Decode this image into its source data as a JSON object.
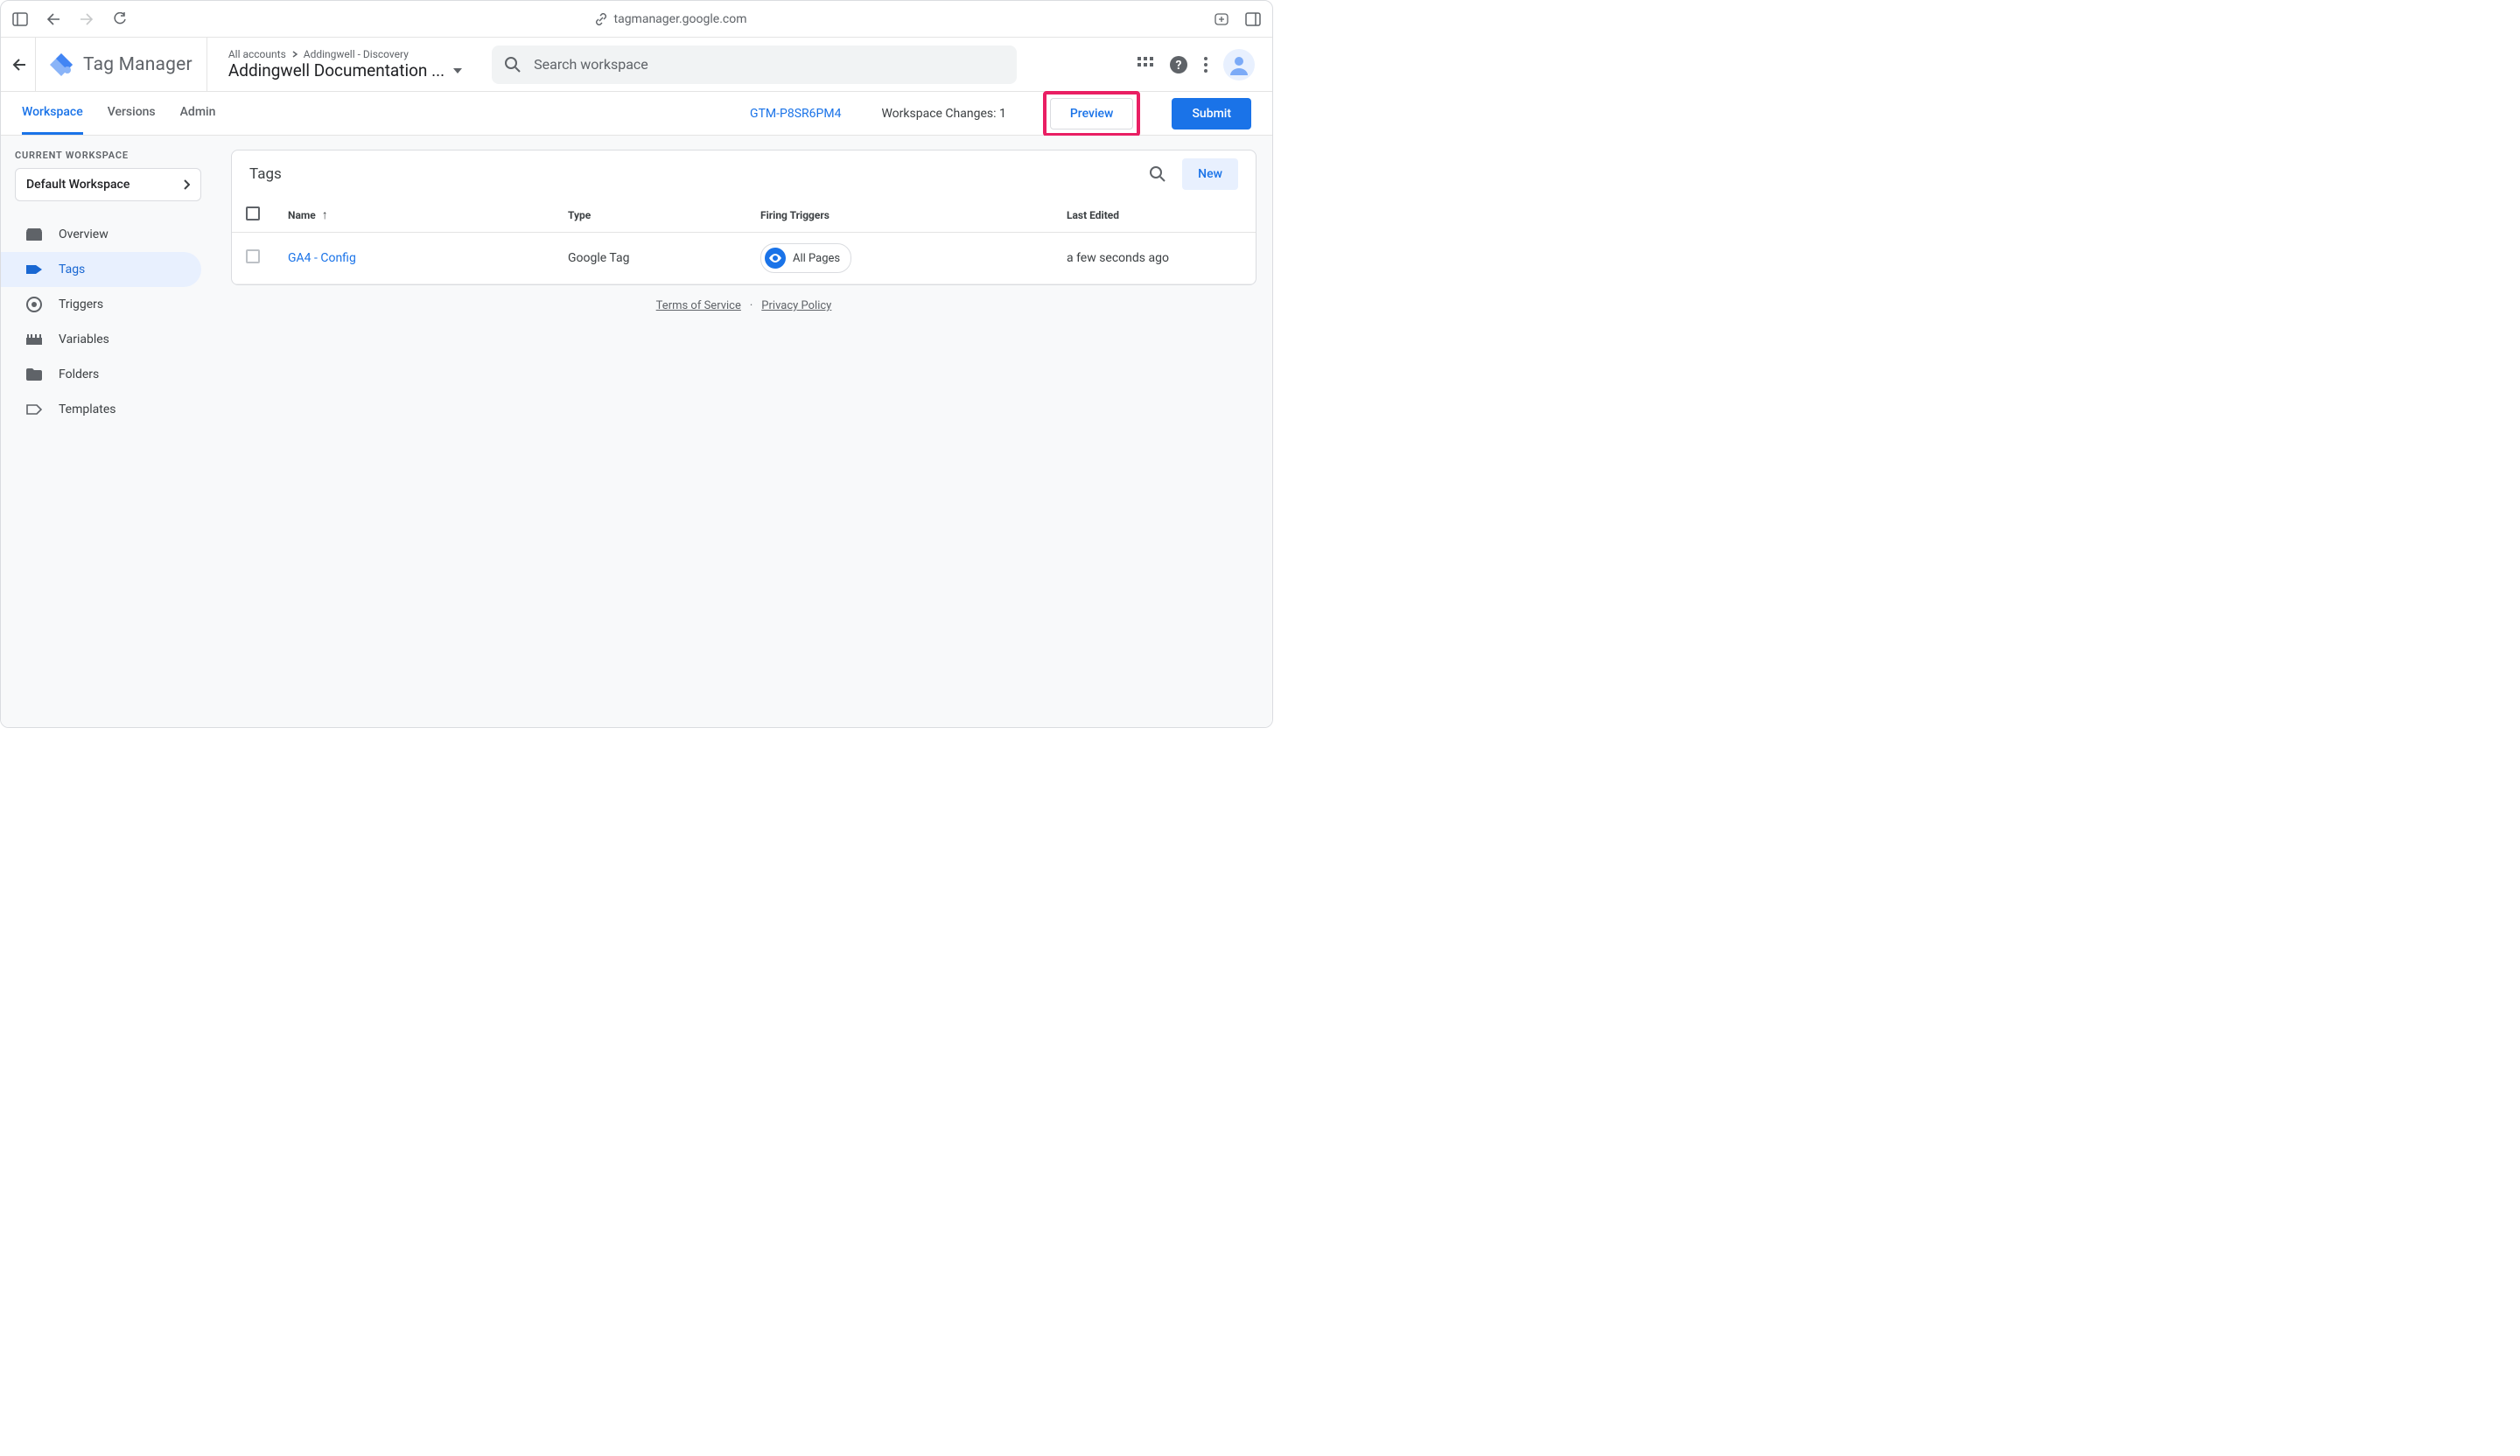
{
  "browser": {
    "url": "tagmanager.google.com"
  },
  "header": {
    "product": "Tag Manager",
    "breadcrumb_root": "All accounts",
    "breadcrumb_account": "Addingwell - Discovery",
    "container_title": "Addingwell Documentation ...",
    "search_placeholder": "Search workspace"
  },
  "tabs": {
    "workspace": "Workspace",
    "versions": "Versions",
    "admin": "Admin"
  },
  "status": {
    "container_id": "GTM-P8SR6PM4",
    "changes_label": "Workspace Changes:",
    "changes_count": "1",
    "preview": "Preview",
    "submit": "Submit"
  },
  "sidebar": {
    "section_label": "CURRENT WORKSPACE",
    "workspace_name": "Default Workspace",
    "items": {
      "overview": "Overview",
      "tags": "Tags",
      "triggers": "Triggers",
      "variables": "Variables",
      "folders": "Folders",
      "templates": "Templates"
    }
  },
  "panel": {
    "title": "Tags",
    "new_label": "New",
    "columns": {
      "name": "Name",
      "type": "Type",
      "triggers": "Firing Triggers",
      "edited": "Last Edited"
    }
  },
  "rows": [
    {
      "name": "GA4 - Config",
      "type": "Google Tag",
      "trigger": "All Pages",
      "edited": "a few seconds ago"
    }
  ],
  "footer": {
    "tos": "Terms of Service",
    "privacy": "Privacy Policy"
  }
}
